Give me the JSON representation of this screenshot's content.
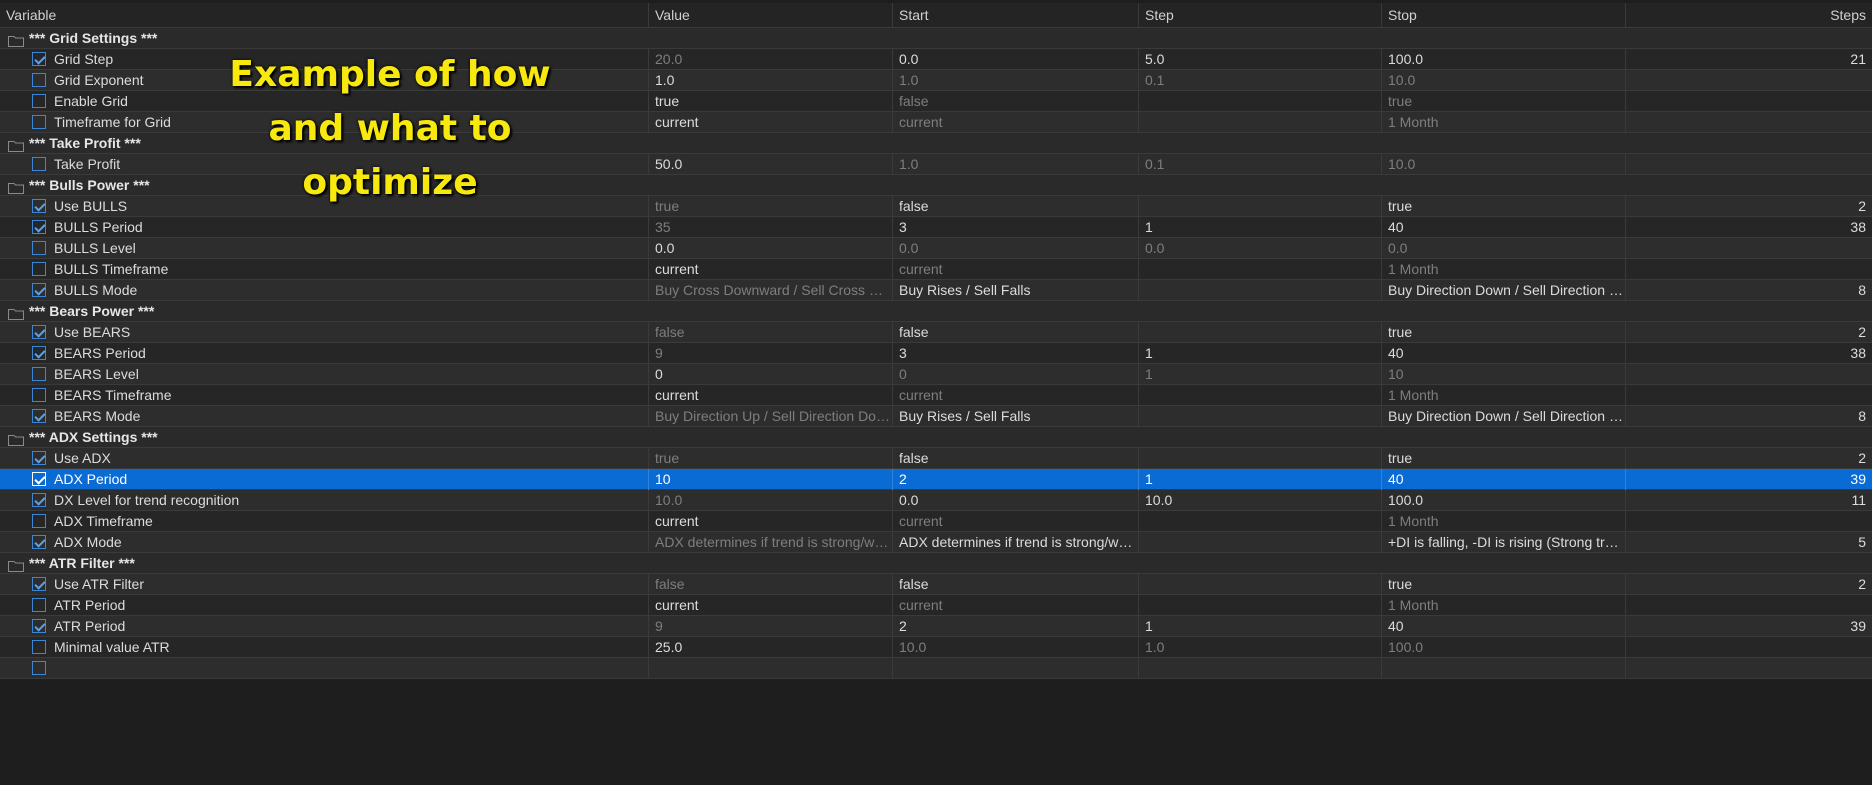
{
  "columns": {
    "variable": "Variable",
    "value": "Value",
    "start": "Start",
    "step": "Step",
    "stop": "Stop",
    "steps": "Steps"
  },
  "annotation": "Example of how\nand what to\noptimize",
  "colors": {
    "selection": "#0b6bd4",
    "checkbox": "#3c86d8",
    "annotation": "#f7e80e",
    "background": "#1e1e1e"
  },
  "rows": [
    {
      "type": "group",
      "label": "*** Grid Settings ***"
    },
    {
      "type": "item",
      "checked": true,
      "label": "Grid Step",
      "value": "20.0",
      "start": "0.0",
      "step": "5.0",
      "stop": "100.0",
      "steps": "21"
    },
    {
      "type": "item",
      "checked": false,
      "label": "Grid Exponent",
      "value": "1.0",
      "start": "1.0",
      "step": "0.1",
      "stop": "10.0",
      "steps": ""
    },
    {
      "type": "item",
      "checked": false,
      "label": "Enable Grid",
      "value": "true",
      "start": "false",
      "step": "",
      "stop": "true",
      "steps": ""
    },
    {
      "type": "item",
      "checked": false,
      "label": "Timeframe for Grid",
      "value": "current",
      "start": "current",
      "step": "",
      "stop": "1 Month",
      "steps": ""
    },
    {
      "type": "group",
      "label": "*** Take Profit ***"
    },
    {
      "type": "item",
      "checked": false,
      "label": "Take Profit",
      "value": "50.0",
      "start": "1.0",
      "step": "0.1",
      "stop": "10.0",
      "steps": ""
    },
    {
      "type": "group",
      "label": "*** Bulls Power ***"
    },
    {
      "type": "item",
      "checked": true,
      "label": "Use BULLS",
      "value": "true",
      "start": "false",
      "step": "",
      "stop": "true",
      "steps": "2"
    },
    {
      "type": "item",
      "checked": true,
      "label": "BULLS Period",
      "value": "35",
      "start": "3",
      "step": "1",
      "stop": "40",
      "steps": "38"
    },
    {
      "type": "item",
      "checked": false,
      "label": "BULLS Level",
      "value": "0.0",
      "start": "0.0",
      "step": "0.0",
      "stop": "0.0",
      "steps": ""
    },
    {
      "type": "item",
      "checked": false,
      "label": "BULLS Timeframe",
      "value": "current",
      "start": "current",
      "step": "",
      "stop": "1 Month",
      "steps": ""
    },
    {
      "type": "item",
      "checked": true,
      "label": "BULLS Mode",
      "value": "Buy Cross Downward / Sell Cross Upward",
      "start": "Buy Rises / Sell Falls",
      "step": "",
      "stop": "Buy Direction Down / Sell Direction Up",
      "steps": "8"
    },
    {
      "type": "group",
      "label": "*** Bears Power ***"
    },
    {
      "type": "item",
      "checked": true,
      "label": "Use BEARS",
      "value": "false",
      "start": "false",
      "step": "",
      "stop": "true",
      "steps": "2"
    },
    {
      "type": "item",
      "checked": true,
      "label": "BEARS Period",
      "value": "9",
      "start": "3",
      "step": "1",
      "stop": "40",
      "steps": "38"
    },
    {
      "type": "item",
      "checked": false,
      "label": "BEARS Level",
      "value": "0",
      "start": "0",
      "step": "1",
      "stop": "10",
      "steps": ""
    },
    {
      "type": "item",
      "checked": false,
      "label": "BEARS Timeframe",
      "value": "current",
      "start": "current",
      "step": "",
      "stop": "1 Month",
      "steps": ""
    },
    {
      "type": "item",
      "checked": true,
      "label": "BEARS Mode",
      "value": "Buy Direction Up / Sell Direction Down",
      "start": "Buy Rises / Sell Falls",
      "step": "",
      "stop": "Buy Direction Down / Sell Direction Up",
      "steps": "8"
    },
    {
      "type": "group",
      "label": "*** ADX Settings ***"
    },
    {
      "type": "item",
      "checked": true,
      "label": "Use ADX",
      "value": "true",
      "start": "false",
      "step": "",
      "stop": "true",
      "steps": "2"
    },
    {
      "type": "item",
      "checked": true,
      "selected": true,
      "label": "ADX Period",
      "value": "10",
      "start": "2",
      "step": "1",
      "stop": "40",
      "steps": "39"
    },
    {
      "type": "item",
      "checked": true,
      "label": "DX Level for trend recognition",
      "value": "10.0",
      "start": "0.0",
      "step": "10.0",
      "stop": "100.0",
      "steps": "11"
    },
    {
      "type": "item",
      "checked": false,
      "label": "ADX Timeframe",
      "value": "current",
      "start": "current",
      "step": "",
      "stop": "1 Month",
      "steps": ""
    },
    {
      "type": "item",
      "checked": true,
      "label": "ADX Mode",
      "value": "ADX determines if trend is strong/weak",
      "start": "ADX determines if trend is strong/weak",
      "step": "",
      "stop": "+DI is falling, -DI is rising (Strong trend)",
      "steps": "5"
    },
    {
      "type": "group",
      "label": "*** ATR Filter ***"
    },
    {
      "type": "item",
      "checked": true,
      "label": "Use ATR Filter",
      "value": "false",
      "start": "false",
      "step": "",
      "stop": "true",
      "steps": "2"
    },
    {
      "type": "item",
      "checked": false,
      "label": "ATR Period",
      "value": "current",
      "start": "current",
      "step": "",
      "stop": "1 Month",
      "steps": ""
    },
    {
      "type": "item",
      "checked": true,
      "label": "ATR Period",
      "value": "9",
      "start": "2",
      "step": "1",
      "stop": "40",
      "steps": "39"
    },
    {
      "type": "item",
      "checked": false,
      "label": "Minimal value ATR",
      "value": "25.0",
      "start": "10.0",
      "step": "1.0",
      "stop": "100.0",
      "steps": ""
    },
    {
      "type": "item",
      "checked": false,
      "label": "",
      "value": "",
      "start": "",
      "step": "",
      "stop": "",
      "steps": ""
    }
  ]
}
